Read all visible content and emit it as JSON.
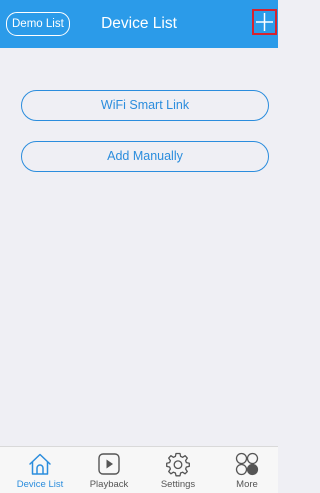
{
  "header": {
    "demo_label": "Demo List",
    "title": "Device List",
    "add_icon": "plus-icon"
  },
  "actions": {
    "wifi_label": "WiFi Smart Link",
    "manual_label": "Add Manually"
  },
  "tabbar": {
    "items": [
      {
        "label": "Device List",
        "icon": "home-icon",
        "active": true
      },
      {
        "label": "Playback",
        "icon": "play-icon",
        "active": false
      },
      {
        "label": "Settings",
        "icon": "gear-icon",
        "active": false
      },
      {
        "label": "More",
        "icon": "grid-icon",
        "active": false
      }
    ]
  },
  "colors": {
    "header_bg": "#2b9be9",
    "accent": "#2b8ddd",
    "background": "#efeff4",
    "highlight_border": "#d6232f"
  }
}
